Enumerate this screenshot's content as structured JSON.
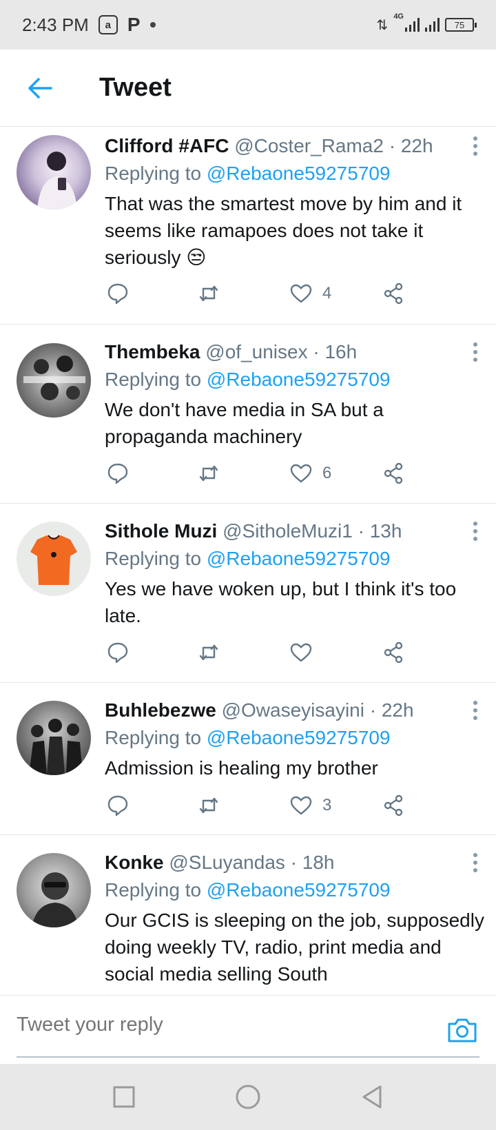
{
  "status_bar": {
    "time": "2:43 PM",
    "app_icon_letter": "a",
    "p_icon_letter": "P",
    "network": "4G",
    "battery": "75"
  },
  "header": {
    "title": "Tweet",
    "back_icon": "arrow-left-icon",
    "accent": "#1da1f2"
  },
  "tweets": [
    {
      "name": "Clifford #AFC",
      "handle": "@Coster_Rama2",
      "time": "· 22h",
      "replying_prefix": "Replying to",
      "replying_to": "@Rebaone59275709",
      "text": "That was the smartest move by him and it seems like ramapoes does not take it seriously 😒",
      "likes": "4"
    },
    {
      "name": "Thembeka",
      "handle": "@of_unisex",
      "time": "· 16h",
      "replying_prefix": "Replying to",
      "replying_to": "@Rebaone59275709",
      "text": "We don't have media in SA but a propaganda machinery",
      "likes": "6"
    },
    {
      "name": "Sithole Muzi",
      "handle": "@SitholeMuzi1",
      "time": "· 13h",
      "replying_prefix": "Replying to",
      "replying_to": "@Rebaone59275709",
      "text": "Yes we have woken up, but I think it's too late.",
      "likes": ""
    },
    {
      "name": "Buhlebezwe",
      "handle": "@Owaseyisayini",
      "time": "· 22h",
      "replying_prefix": "Replying to",
      "replying_to": "@Rebaone59275709",
      "text": "Admission is healing my brother",
      "likes": "3"
    },
    {
      "name": "Konke",
      "handle": "@SLuyandas",
      "time": "· 18h",
      "replying_prefix": "Replying to",
      "replying_to": "@Rebaone59275709",
      "text": "Our GCIS is sleeping on the job, supposedly doing weekly TV,  radio, print media and social media selling South",
      "likes": ""
    }
  ],
  "reply_bar": {
    "placeholder": "Tweet your reply",
    "camera_icon": "camera-icon"
  },
  "nav_bar": {
    "buttons": [
      "recents-square-icon",
      "home-circle-icon",
      "back-triangle-icon"
    ]
  }
}
